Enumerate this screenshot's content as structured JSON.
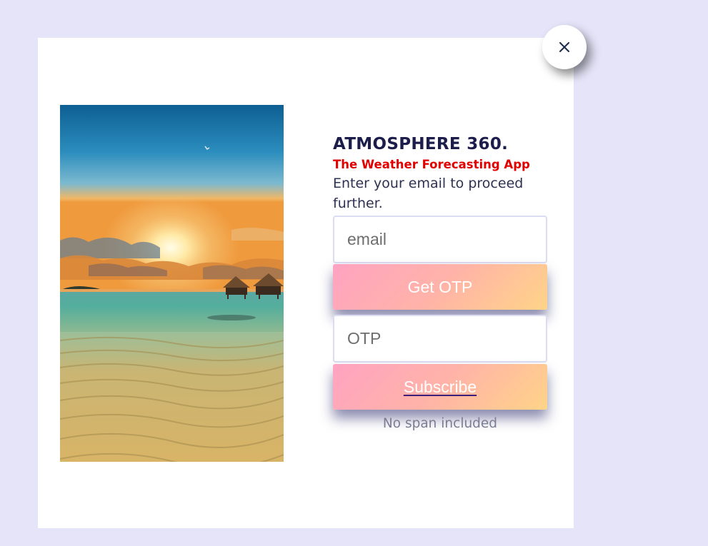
{
  "modal": {
    "title": "ATMOSPHERE 360.",
    "subtitle": "The Weather Forecasting App",
    "description": "Enter your email to proceed further.",
    "email_placeholder": "email",
    "get_otp_label": "Get OTP",
    "otp_placeholder": "OTP",
    "subscribe_label": "Subscribe",
    "note": "No span included",
    "close_icon": "close-icon",
    "image": "beach-sunset-image"
  },
  "colors": {
    "page_background": "#e5e4f8",
    "modal_background": "#ffffff",
    "title": "#1c1d4a",
    "subtitle": "#e00000",
    "button_gradient_start": "#ffa3c2",
    "button_gradient_end": "#ffd488"
  }
}
